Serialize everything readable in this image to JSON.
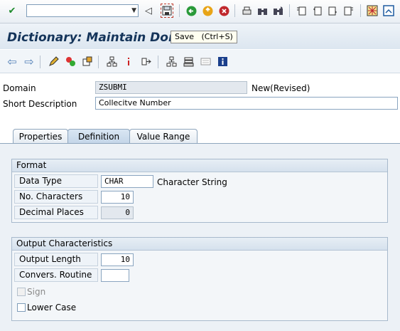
{
  "toolbar": {
    "command_field_value": "",
    "icons": [
      "enter-icon",
      "back-arrow-icon",
      "save-icon",
      "back-icon",
      "exit-icon",
      "cancel-icon",
      "print-icon",
      "find-icon",
      "find-next-icon",
      "first-page-icon",
      "previous-page-icon",
      "next-page-icon",
      "last-page-icon",
      "customize-layout-icon",
      "help-icon"
    ]
  },
  "title": {
    "text": "Dictionary: Maintain Domain"
  },
  "tooltip": {
    "text": "Save   (Ctrl+S)"
  },
  "app_toolbar": {
    "icons": [
      "back-icon",
      "forward-icon",
      "edit-icon",
      "activate-icon",
      "other-object-icon",
      "hierarchy-icon",
      "where-used-icon",
      "navigate-icon",
      "display-object-list-icon",
      "technical-settings-icon",
      "documentation-icon",
      "info-icon"
    ]
  },
  "header": {
    "domain_label": "Domain",
    "domain_value": "ZSUBMI",
    "domain_status": "New(Revised)",
    "short_desc_label": "Short Description",
    "short_desc_value": "Collecitve Number"
  },
  "tabs": [
    {
      "label": "Properties",
      "active": false
    },
    {
      "label": "Definition",
      "active": true
    },
    {
      "label": "Value Range",
      "active": false
    }
  ],
  "format": {
    "title": "Format",
    "data_type_label": "Data Type",
    "data_type_value": "CHAR",
    "data_type_desc": "Character String",
    "no_chars_label": "No. Characters",
    "no_chars_value": "10",
    "decimal_label": "Decimal Places",
    "decimal_value": "0"
  },
  "output": {
    "title": "Output Characteristics",
    "output_length_label": "Output Length",
    "output_length_value": "10",
    "convers_routine_label": "Convers. Routine",
    "convers_routine_value": "",
    "sign_label": "Sign",
    "sign_checked": false,
    "lower_case_label": "Lower Case",
    "lower_case_checked": false
  }
}
